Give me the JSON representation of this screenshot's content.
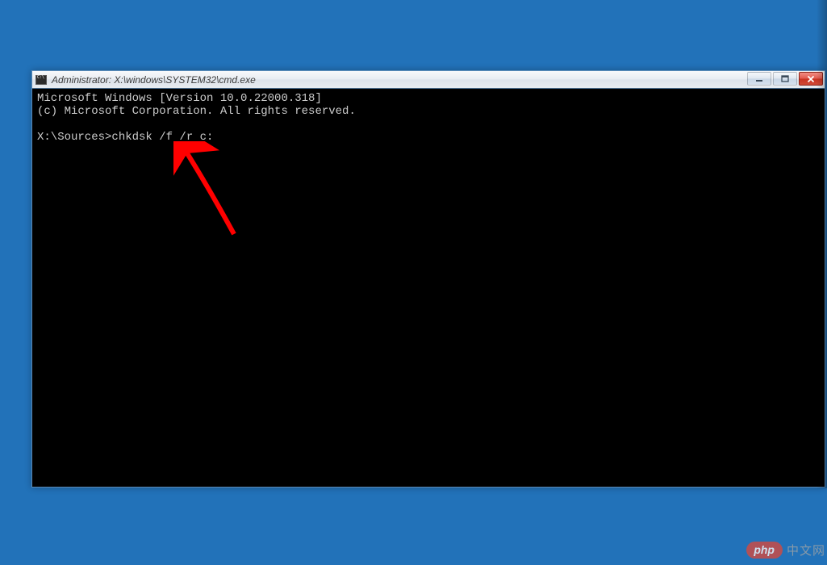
{
  "window": {
    "title": "Administrator: X:\\windows\\SYSTEM32\\cmd.exe"
  },
  "terminal": {
    "line1": "Microsoft Windows [Version 10.0.22000.318]",
    "line2": "(c) Microsoft Corporation. All rights reserved.",
    "blank": "",
    "prompt": "X:\\Sources>",
    "command": "chkdsk /f /r c:"
  },
  "watermark": {
    "pill": "php",
    "text": "中文网"
  }
}
